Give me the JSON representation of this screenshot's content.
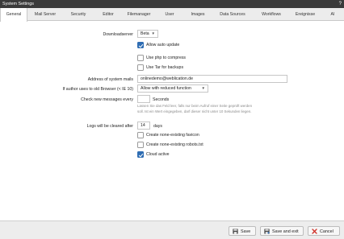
{
  "window": {
    "title": "System Settings",
    "help": "?"
  },
  "tabs": [
    {
      "label": "General",
      "active": true
    },
    {
      "label": "Mail Server",
      "active": false
    },
    {
      "label": "Security",
      "active": false
    },
    {
      "label": "Editor",
      "active": false
    },
    {
      "label": "Filemanager",
      "active": false
    },
    {
      "label": "User",
      "active": false
    },
    {
      "label": "Images",
      "active": false
    },
    {
      "label": "Data Sources",
      "active": false
    },
    {
      "label": "Workflows",
      "active": false
    },
    {
      "label": "Ereignisse",
      "active": false
    },
    {
      "label": "AI",
      "active": false
    }
  ],
  "form": {
    "downloadserver": {
      "label": "Downloadserver",
      "value": "Beta"
    },
    "allow_auto_update": {
      "label": "Allow auto update",
      "checked": true
    },
    "use_php_compress": {
      "label": "Use php to compress",
      "checked": false
    },
    "use_tar_backups": {
      "label": "Use Tar for backups",
      "checked": false
    },
    "system_mails": {
      "label": "Address of system mails",
      "value": "onlinedemo@weblication.de"
    },
    "old_browser": {
      "label": "If author uses to old Browser (< IE 10)",
      "value": "Allow with reduced function"
    },
    "check_messages": {
      "label": "Check new messages every",
      "value": "",
      "unit": "Seconds",
      "hint_line1": "Lassen Sie das Feld leer, falls nur beim Aufruf einer Seite geprüft werden",
      "hint_line2": "soll. Ist ein Wert eingegeben, darf dieser nicht unter 10 Sekunden liegen."
    },
    "logs_cleared": {
      "label": "Logs will be cleared after",
      "value": "14",
      "unit": "days"
    },
    "create_favicon": {
      "label": "Create none-existing favicon",
      "checked": false
    },
    "create_robots": {
      "label": "Create none-existing robots.txt",
      "checked": false
    },
    "cloud_active": {
      "label": "Cloud active",
      "checked": true
    }
  },
  "footer": {
    "save": "Save",
    "save_exit": "Save and exit",
    "cancel": "Cancel"
  },
  "colors": {
    "titlebar": "#3b3b3b",
    "accent": "#2f6db3",
    "cancel_icon": "#d0342c"
  }
}
